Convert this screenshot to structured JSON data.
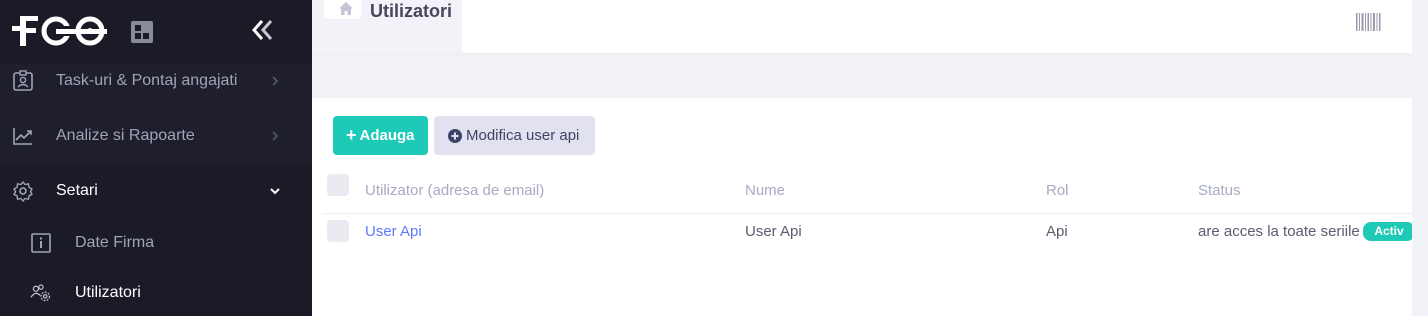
{
  "app": {
    "brand": "FGO"
  },
  "sidebar": {
    "items": [
      {
        "label": "Task-uri & Pontaj angajati",
        "icon": "id-badge-icon"
      },
      {
        "label": "Analize si Rapoarte",
        "icon": "chart-line-icon"
      },
      {
        "label": "Setari",
        "icon": "gear-icon"
      }
    ],
    "subitems": [
      {
        "label": "Date Firma",
        "icon": "info-box-icon"
      },
      {
        "label": "Utilizatori",
        "icon": "users-gear-icon"
      }
    ]
  },
  "header": {
    "title": "Utilizatori"
  },
  "toolbar": {
    "add_label": "Adauga",
    "modify_label": "Modifica user api"
  },
  "table": {
    "columns": [
      "Utilizator (adresa de email)",
      "Nume",
      "Rol",
      "Status"
    ],
    "rows": [
      {
        "user": "User Api",
        "name": "User Api",
        "role": "Api",
        "status": "are acces la toate seriile",
        "badge": "Activ"
      }
    ]
  },
  "colors": {
    "sidebar_bg": "#1e1e2d",
    "accent": "#1dc9b7",
    "link": "#5d78ff"
  }
}
